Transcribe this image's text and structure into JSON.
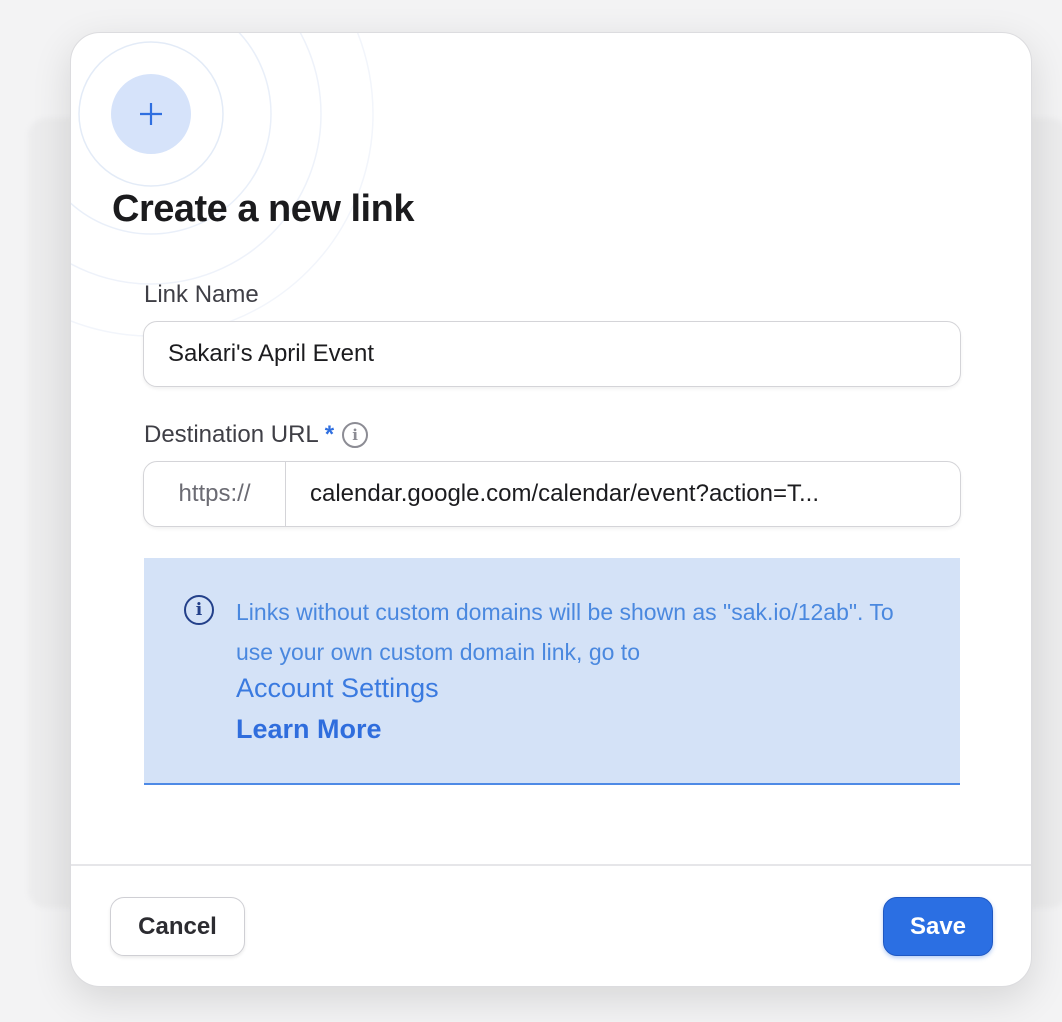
{
  "modal": {
    "title": "Create a new link",
    "plus_icon": "plus-icon"
  },
  "form": {
    "link_name_label": "Link Name",
    "link_name_value": "Sakari's April Event",
    "destination_label": "Destination URL",
    "required_marker": "*",
    "destination_info_icon": "info-icon",
    "url_prefix": "https://",
    "url_value": "calendar.google.com/calendar/event?action=T..."
  },
  "notice": {
    "icon": "info-icon",
    "text": "Links without custom domains will be shown as \"sak.io/12ab\". To use your own custom domain link, go to",
    "account_settings_link": "Account Settings",
    "learn_more_link": "Learn More"
  },
  "footer": {
    "cancel_label": "Cancel",
    "save_label": "Save"
  },
  "colors": {
    "accent": "#2b6fe3",
    "notice_bg": "#d4e2f7",
    "badge_bg": "#d6e3fa"
  }
}
